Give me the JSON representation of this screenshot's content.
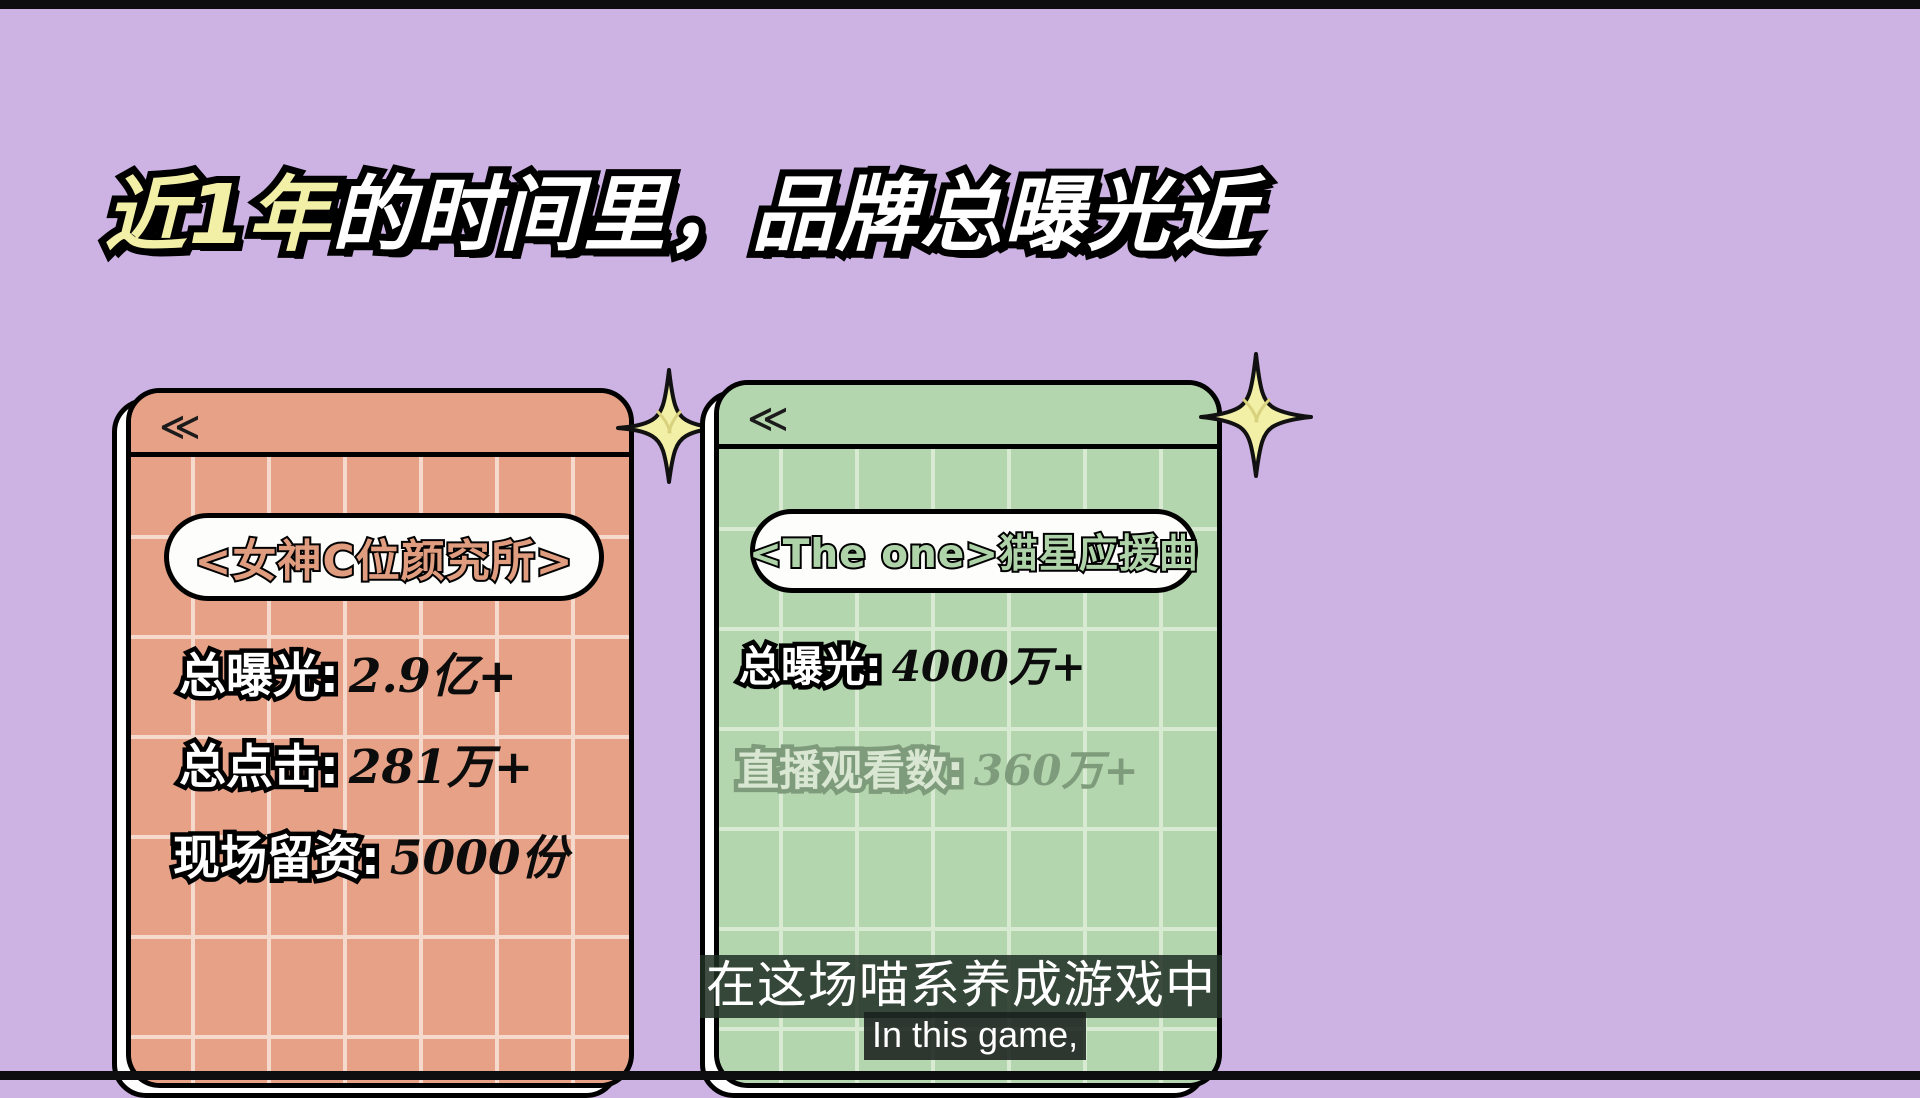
{
  "background_color": "#CDB2E4",
  "headline": {
    "part_highlight": "近1年",
    "part_rest": "的时间里，品牌总曝光近",
    "highlight_color": "#F2EFA6",
    "rest_color": "#FFFFFF",
    "outline_color": "#000000"
  },
  "cards": [
    {
      "id": "card-salmon",
      "theme_color": "#E6A186",
      "grid_line_color": "#F4D9CC",
      "header_nav_icon": "≪",
      "title": "<女神C位颜究所>",
      "title_text_color": "#E09C7F",
      "sparkle_icon": "four-point-star",
      "sparkle_color": "#F2EFA6",
      "stats": [
        {
          "label": "总曝光:",
          "value": "2.9亿+",
          "faded": false
        },
        {
          "label": "总点击:",
          "value": "281万+",
          "faded": false
        },
        {
          "label": "现场留资:",
          "value": "5000份",
          "faded": false
        }
      ]
    },
    {
      "id": "card-green",
      "theme_color": "#B4D6AE",
      "grid_line_color": "#D8EBD2",
      "header_nav_icon": "≪",
      "title": "<The one>猫星应援曲",
      "title_text_color": "#AFD3A9",
      "sparkle_icon": "four-point-star",
      "sparkle_color": "#F2EFA6",
      "stats": [
        {
          "label": "总曝光:",
          "value": "4000万+",
          "faded": false
        },
        {
          "label": "直播观看数:",
          "value": "360万+",
          "faded": true
        }
      ]
    }
  ],
  "subtitles": {
    "chinese": "在这场喵系养成游戏中",
    "english": "In this game,",
    "box_color_cn": "rgba(32,48,36,0.86)",
    "box_color_en": "rgba(26,33,30,0.88)",
    "text_color": "#FFFFFF"
  }
}
